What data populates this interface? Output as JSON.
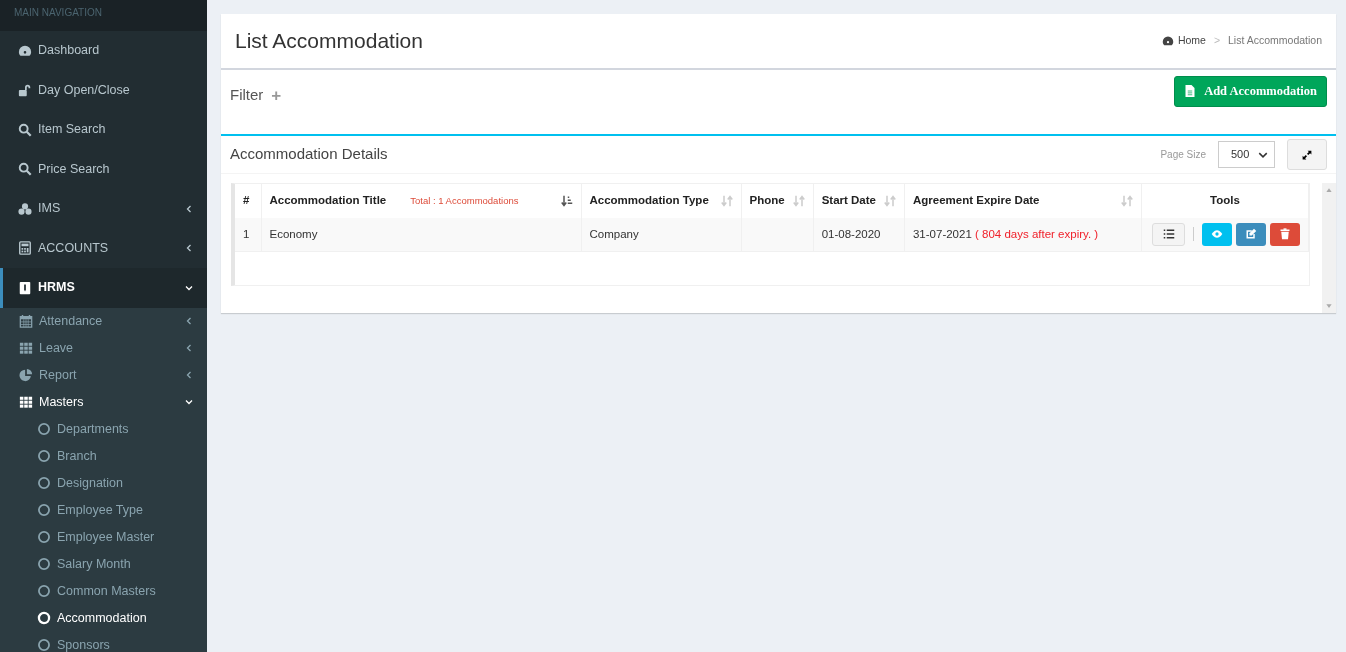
{
  "sidebar": {
    "header": "MAIN NAVIGATION",
    "items": [
      {
        "label": "Dashboard",
        "kind": "link",
        "selected": false
      },
      {
        "label": "Day Open/Close",
        "kind": "link",
        "selected": false
      },
      {
        "label": "Item Search",
        "kind": "link",
        "selected": false
      },
      {
        "label": "Price Search",
        "kind": "link",
        "selected": false
      },
      {
        "label": "IMS",
        "kind": "tree",
        "selected": false,
        "expanded": false
      },
      {
        "label": "ACCOUNTS",
        "kind": "tree",
        "selected": false,
        "expanded": false
      },
      {
        "label": "HRMS",
        "kind": "tree",
        "selected": true,
        "expanded": true,
        "children": [
          {
            "label": "Attendance",
            "kind": "tree",
            "selected": false,
            "expanded": false
          },
          {
            "label": "Leave",
            "kind": "tree",
            "selected": false,
            "expanded": false
          },
          {
            "label": "Report",
            "kind": "tree",
            "selected": false,
            "expanded": false
          },
          {
            "label": "Masters",
            "kind": "tree",
            "selected": true,
            "expanded": true,
            "children": [
              {
                "label": "Departments",
                "selected": false
              },
              {
                "label": "Branch",
                "selected": false
              },
              {
                "label": "Designation",
                "selected": false
              },
              {
                "label": "Employee Type",
                "selected": false
              },
              {
                "label": "Employee Master",
                "selected": false
              },
              {
                "label": "Salary Month",
                "selected": false
              },
              {
                "label": "Common Masters",
                "selected": false
              },
              {
                "label": "Accommodation",
                "selected": true
              },
              {
                "label": "Sponsors",
                "selected": false
              }
            ]
          }
        ]
      }
    ]
  },
  "page": {
    "title": "List Accommodation",
    "breadcrumb": [
      "Home",
      ">",
      "List Accommodation"
    ]
  },
  "filter": {
    "label": "Filter",
    "toggle": "+",
    "add_button": "Add Accommodation"
  },
  "details": {
    "title": "Accommodation Details",
    "page_size_label": "Page Size",
    "page_size": "500",
    "table": {
      "columns": [
        {
          "label": "#",
          "sortable": false
        },
        {
          "label": "Accommodation Title",
          "note": "Total : 1 Accommodations",
          "sortable": true,
          "sorted": true
        },
        {
          "label": "Accommodation Type",
          "sortable": true,
          "sorted": false
        },
        {
          "label": "Phone",
          "sortable": true,
          "sorted": false
        },
        {
          "label": "Start Date",
          "sortable": true,
          "sorted": false
        },
        {
          "label": "Agreement Expire Date",
          "sortable": true,
          "sorted": false
        },
        {
          "label": "Tools",
          "sortable": false
        }
      ],
      "rows": [
        {
          "cells": [
            "1",
            "Economy",
            "Company",
            "",
            "01-08-2020",
            "31-07-2021"
          ],
          "expiry_note": "( 804 days after expiry. )",
          "tools": [
            {
              "kind": "list"
            },
            {
              "kind": "view"
            },
            {
              "kind": "edit"
            },
            {
              "kind": "delete"
            }
          ]
        }
      ]
    }
  }
}
